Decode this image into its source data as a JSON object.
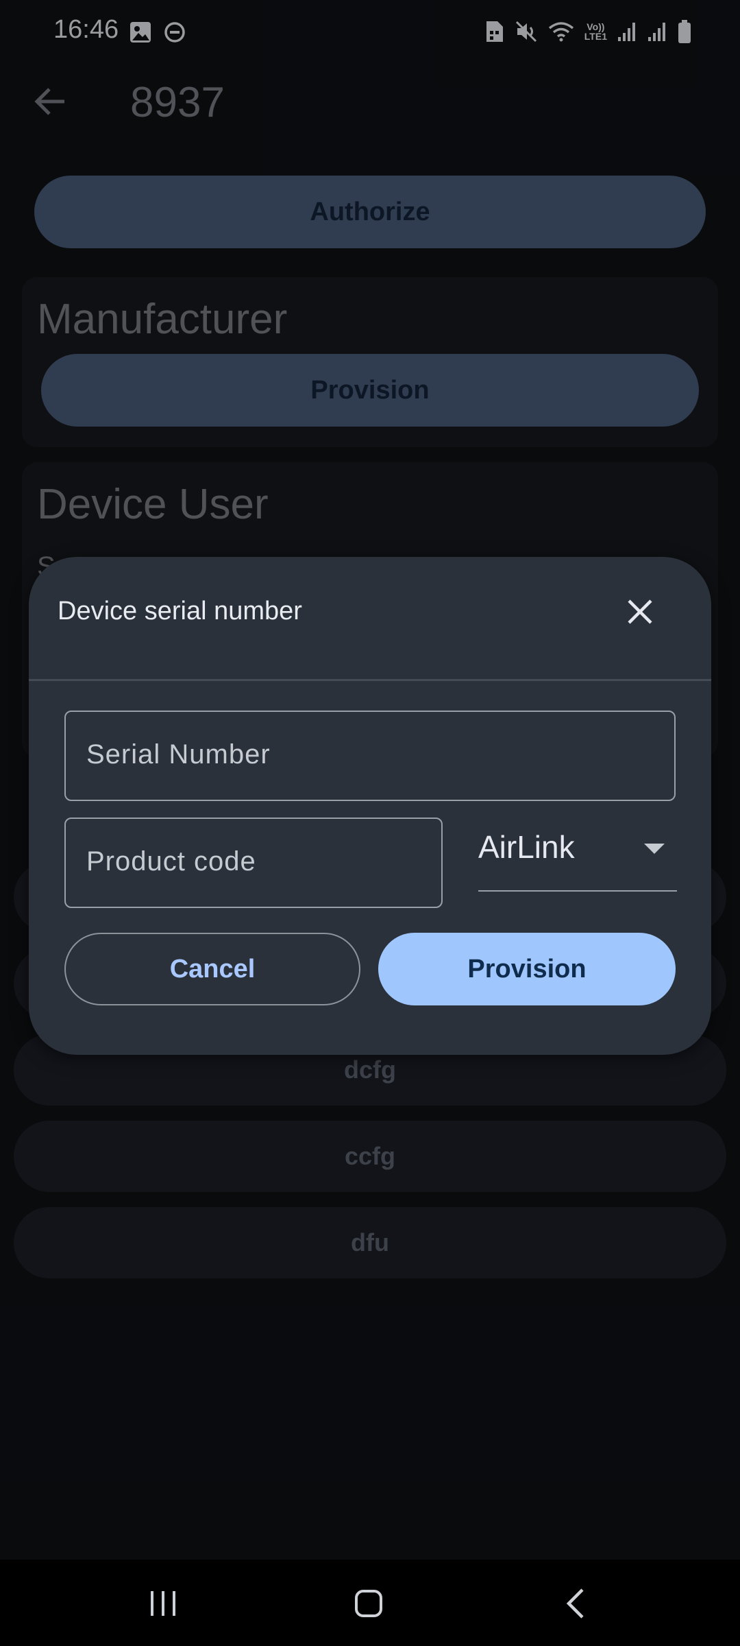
{
  "status_bar": {
    "time": "16:46",
    "left_icons": [
      "image-icon",
      "do-not-disturb-icon"
    ],
    "right_icons": [
      "sim-card-icon",
      "mute-icon",
      "wifi-icon",
      "volte-icon",
      "signal-icon",
      "signal-icon",
      "battery-icon"
    ],
    "volte_line1": "Vo))",
    "volte_line2": "LTE1"
  },
  "app_bar": {
    "title": "8937",
    "back_icon": "arrow-back-icon"
  },
  "background": {
    "authorize_label": "Authorize",
    "manufacturer_title": "Manufacturer",
    "manufacturer_provision_label": "Provision",
    "device_user_title": "Device User",
    "device_user_partial": "S",
    "list_buttons": [
      "dcfg",
      "ccfg",
      "dfu"
    ]
  },
  "dialog": {
    "title": "Device serial number",
    "close_icon": "close-icon",
    "serial_placeholder": "Serial Number",
    "product_code_placeholder": "Product code",
    "dropdown_value": "AirLink",
    "cancel_label": "Cancel",
    "provision_label": "Provision"
  },
  "nav_bar": {
    "icons": [
      "recents-icon",
      "home-icon",
      "back-icon"
    ]
  },
  "colors": {
    "accent": "#9fc7fd",
    "dim_button": "#4a5d7a",
    "dialog_bg": "#2b313b"
  }
}
